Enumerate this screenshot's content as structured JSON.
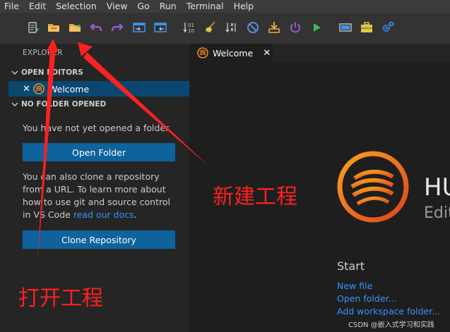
{
  "menu": [
    "File",
    "Edit",
    "Selection",
    "View",
    "Go",
    "Run",
    "Terminal",
    "Help"
  ],
  "toolbar": {
    "icons": [
      "new-file-icon",
      "open-folder-icon",
      "new-folder-icon",
      "undo-icon",
      "redo-icon",
      "window-in-icon",
      "window-out-icon",
      "sort-numbers-icon",
      "broom-icon",
      "debug-tools-icon",
      "stop-circle-icon",
      "download-icon",
      "power-icon",
      "run-icon",
      "device-icon",
      "toolbox-icon",
      "gear-network-icon"
    ],
    "colors": {
      "accent": "#e8a33a",
      "action": "#9b59d0",
      "run": "#3fb950",
      "blue": "#3794ff"
    }
  },
  "sidebar": {
    "title": "EXPLORER",
    "open_editors": {
      "header": "OPEN EDITORS",
      "items": [
        {
          "label": "Welcome"
        }
      ]
    },
    "no_folder": {
      "header": "NO FOLDER OPENED",
      "message": "You have not yet opened a folder.",
      "open_button": "Open Folder",
      "clone_text_pre": "You can also clone a repository from a URL. To learn more about how to use git and source control in VS Code",
      "clone_link": "read our docs",
      "clone_text_post": ".",
      "clone_button": "Clone Repository"
    }
  },
  "editor": {
    "tab": {
      "label": "Welcome",
      "close_glyph": "✕"
    },
    "welcome": {
      "brand_title": "HU",
      "brand_subtitle": "Edit",
      "start": {
        "heading": "Start",
        "links": [
          "New file",
          "Open folder...",
          "Add workspace folder..."
        ]
      }
    }
  },
  "annotations": {
    "new_project": "新建工程",
    "open_project": "打开工程",
    "color": "#ff2020"
  },
  "watermark": "CSDN @嵌入式学习和实践"
}
